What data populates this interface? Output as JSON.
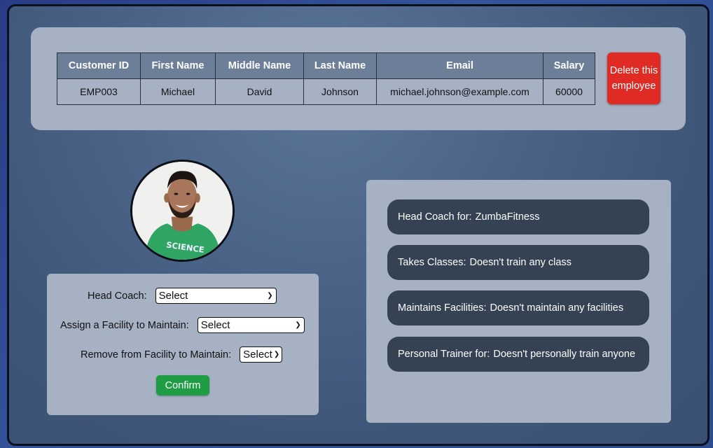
{
  "employee_table": {
    "headers": [
      "Customer ID",
      "First Name",
      "Middle Name",
      "Last Name",
      "Email",
      "Salary"
    ],
    "row": [
      "EMP003",
      "Michael",
      "David",
      "Johnson",
      "michael.johnson@example.com",
      "60000"
    ]
  },
  "delete_button": {
    "label": "Delete this employee"
  },
  "avatar": {
    "icon": "employee-photo"
  },
  "form": {
    "head_coach_label": "Head Coach:",
    "head_coach_value": "Select",
    "assign_facility_label": "Assign a Facility to Maintain:",
    "assign_facility_value": "Select",
    "remove_facility_label": "Remove from Facility to Maintain:",
    "remove_facility_value": "Select",
    "confirm_label": "Confirm"
  },
  "info": {
    "head_coach": {
      "label": "Head Coach for:",
      "value": "ZumbaFitness"
    },
    "takes_classes": {
      "label": "Takes Classes:",
      "value": "Doesn't train any class"
    },
    "maintains": {
      "label": "Maintains Facilities:",
      "value": "Doesn't maintain any facilities"
    },
    "personal_trainer": {
      "label": "Personal Trainer for:",
      "value": "Doesn't personally train anyone"
    }
  },
  "colors": {
    "delete": "#e02b25",
    "confirm": "#1f9d45",
    "card": "#a6b1c3",
    "pill": "#344254",
    "table_header": "#6d7e98"
  }
}
